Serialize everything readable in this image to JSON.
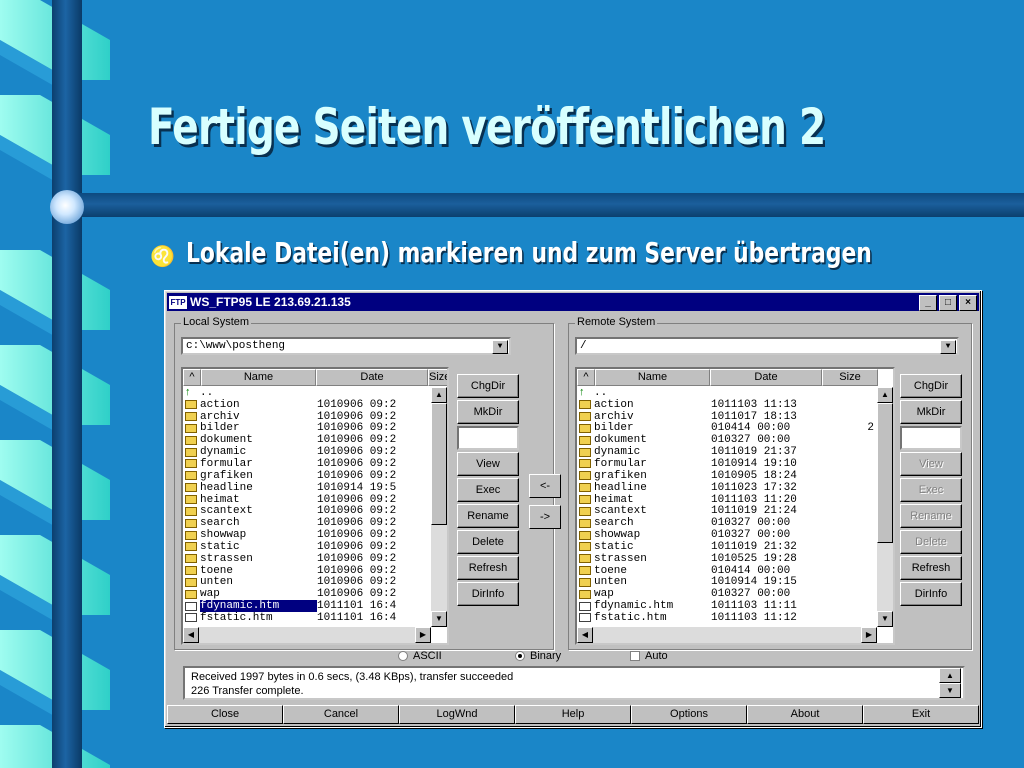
{
  "slide": {
    "title": "Fertige Seiten veröffentlichen 2",
    "bullet_glyph": "b",
    "subtitle": "Lokale Datei(en) markieren und zum Server übertragen"
  },
  "window": {
    "icon_text": "FTP",
    "title": "WS_FTP95 LE 213.69.21.135",
    "minimize": "_",
    "maximize": "□",
    "close": "×"
  },
  "local": {
    "group_label": "Local System",
    "path": "c:\\www\\postheng",
    "columns": [
      "^",
      "Name",
      "Date",
      "Size"
    ],
    "rows": [
      {
        "icon": "up-icon",
        "name": "..",
        "date": ""
      },
      {
        "icon": "folder-icon",
        "name": "action",
        "date": "1010906 09:2"
      },
      {
        "icon": "folder-icon",
        "name": "archiv",
        "date": "1010906 09:2"
      },
      {
        "icon": "folder-icon",
        "name": "bilder",
        "date": "1010906 09:2"
      },
      {
        "icon": "folder-icon",
        "name": "dokument",
        "date": "1010906 09:2"
      },
      {
        "icon": "folder-icon",
        "name": "dynamic",
        "date": "1010906 09:2"
      },
      {
        "icon": "folder-icon",
        "name": "formular",
        "date": "1010906 09:2"
      },
      {
        "icon": "folder-icon",
        "name": "grafiken",
        "date": "1010906 09:2"
      },
      {
        "icon": "folder-icon",
        "name": "headline",
        "date": "1010914 19:5"
      },
      {
        "icon": "folder-icon",
        "name": "heimat",
        "date": "1010906 09:2"
      },
      {
        "icon": "folder-icon",
        "name": "scantext",
        "date": "1010906 09:2"
      },
      {
        "icon": "folder-icon",
        "name": "search",
        "date": "1010906 09:2"
      },
      {
        "icon": "folder-icon",
        "name": "showwap",
        "date": "1010906 09:2"
      },
      {
        "icon": "folder-icon",
        "name": "static",
        "date": "1010906 09:2"
      },
      {
        "icon": "folder-icon",
        "name": "strassen",
        "date": "1010906 09:2"
      },
      {
        "icon": "folder-icon",
        "name": "toene",
        "date": "1010906 09:2"
      },
      {
        "icon": "folder-icon",
        "name": "unten",
        "date": "1010906 09:2"
      },
      {
        "icon": "folder-icon",
        "name": "wap",
        "date": "1010906 09:2"
      },
      {
        "icon": "file-icon",
        "name": "fdynamic.htm",
        "date": "1011101 16:4",
        "selected": true
      },
      {
        "icon": "file-icon",
        "name": "fstatic.htm",
        "date": "1011101 16:4"
      }
    ],
    "buttons": [
      "ChgDir",
      "MkDir",
      "",
      "View",
      "Exec",
      "Rename",
      "Delete",
      "Refresh",
      "DirInfo"
    ]
  },
  "transfer": {
    "to_local": "<-",
    "to_remote": "->"
  },
  "remote": {
    "group_label": "Remote System",
    "path": "/",
    "columns": [
      "^",
      "Name",
      "Date",
      "Size"
    ],
    "rows": [
      {
        "icon": "up-icon",
        "name": "..",
        "date": "",
        "size": ""
      },
      {
        "icon": "folder-icon",
        "name": "action",
        "date": "1011103 11:13",
        "size": ""
      },
      {
        "icon": "folder-icon",
        "name": "archiv",
        "date": "1011017 18:13",
        "size": ""
      },
      {
        "icon": "folder-icon",
        "name": "bilder",
        "date": "010414 00:00",
        "size": "2"
      },
      {
        "icon": "folder-icon",
        "name": "dokument",
        "date": "010327 00:00",
        "size": ""
      },
      {
        "icon": "folder-icon",
        "name": "dynamic",
        "date": "1011019 21:37",
        "size": ""
      },
      {
        "icon": "folder-icon",
        "name": "formular",
        "date": "1010914 19:10",
        "size": ""
      },
      {
        "icon": "folder-icon",
        "name": "grafiken",
        "date": "1010905 18:24",
        "size": ""
      },
      {
        "icon": "folder-icon",
        "name": "headline",
        "date": "1011023 17:32",
        "size": ""
      },
      {
        "icon": "folder-icon",
        "name": "heimat",
        "date": "1011103 11:20",
        "size": ""
      },
      {
        "icon": "folder-icon",
        "name": "scantext",
        "date": "1011019 21:24",
        "size": ""
      },
      {
        "icon": "folder-icon",
        "name": "search",
        "date": "010327 00:00",
        "size": ""
      },
      {
        "icon": "folder-icon",
        "name": "showwap",
        "date": "010327 00:00",
        "size": ""
      },
      {
        "icon": "folder-icon",
        "name": "static",
        "date": "1011019 21:32",
        "size": ""
      },
      {
        "icon": "folder-icon",
        "name": "strassen",
        "date": "1010525 19:28",
        "size": ""
      },
      {
        "icon": "folder-icon",
        "name": "toene",
        "date": "010414 00:00",
        "size": ""
      },
      {
        "icon": "folder-icon",
        "name": "unten",
        "date": "1010914 19:15",
        "size": ""
      },
      {
        "icon": "folder-icon",
        "name": "wap",
        "date": "010327 00:00",
        "size": ""
      },
      {
        "icon": "file-icon",
        "name": "fdynamic.htm",
        "date": "1011103 11:11",
        "size": ""
      },
      {
        "icon": "file-icon",
        "name": "fstatic.htm",
        "date": "1011103 11:12",
        "size": ""
      }
    ],
    "buttons": [
      "ChgDir",
      "MkDir",
      "",
      "View",
      "Exec",
      "Rename",
      "Delete",
      "Refresh",
      "DirInfo"
    ],
    "disabled_buttons": [
      "View",
      "Exec",
      "Rename",
      "Delete"
    ]
  },
  "mode": {
    "ascii": "ASCII",
    "binary": "Binary",
    "auto": "Auto",
    "selected": "Binary",
    "auto_checked": false
  },
  "status": {
    "line1": "Received 1997 bytes in 0.6 secs, (3.48 KBps), transfer succeeded",
    "line2": "226 Transfer complete."
  },
  "bottom_buttons": [
    "Close",
    "Cancel",
    "LogWnd",
    "Help",
    "Options",
    "About",
    "Exit"
  ],
  "colors": {
    "titlebar": "#000080",
    "background": "#1a86c8",
    "selection": "#000080"
  }
}
